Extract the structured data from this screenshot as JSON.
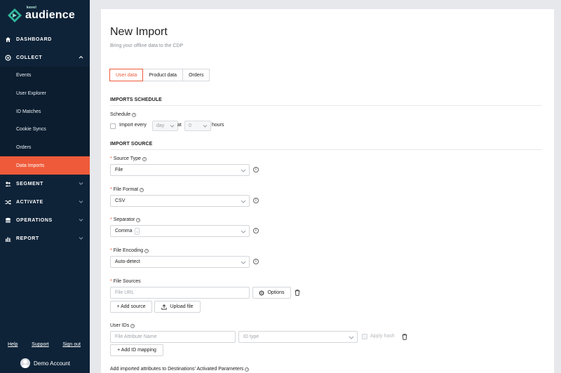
{
  "app": {
    "brand_small": "kevel",
    "brand_name": "audience",
    "accent": "#ef5a3a",
    "sidebar_bg": "#0e2338"
  },
  "sidebar": {
    "sections": [
      {
        "label": "DASHBOARD",
        "icon": "home-icon"
      },
      {
        "label": "COLLECT",
        "icon": "target-icon",
        "expanded": true
      },
      {
        "label": "SEGMENT",
        "icon": "users-icon"
      },
      {
        "label": "ACTIVATE",
        "icon": "shuffle-icon"
      },
      {
        "label": "OPERATIONS",
        "icon": "database-icon"
      },
      {
        "label": "REPORT",
        "icon": "bar-chart-icon"
      }
    ],
    "collect_items": [
      {
        "label": "Events"
      },
      {
        "label": "User Explorer"
      },
      {
        "label": "ID Matches"
      },
      {
        "label": "Cookie Syncs"
      },
      {
        "label": "Orders"
      },
      {
        "label": "Data Imports",
        "active": true
      }
    ],
    "links": {
      "help": "Help",
      "support": "Support",
      "signout": "Sign out"
    },
    "account": "Demo Account"
  },
  "page": {
    "title": "New Import",
    "subtitle": "Bring your offline data to the CDP",
    "tabs": [
      "User data",
      "Product data",
      "Orders"
    ],
    "active_tab": "User data"
  },
  "schedule": {
    "section": "IMPORTS SCHEDULE",
    "label": "Schedule",
    "import_every": "Import every",
    "unit_value": "day",
    "at": "at",
    "hour_value": "0",
    "hours": "hours",
    "checked": false
  },
  "source": {
    "section": "IMPORT SOURCE",
    "source_type_label": "Source Type",
    "source_type_value": "File",
    "file_format_label": "File Format",
    "file_format_value": "CSV",
    "separator_label": "Separator",
    "separator_value": "Comma",
    "separator_char": ",",
    "encoding_label": "File Encoding",
    "encoding_value": "Auto-detect",
    "file_sources_label": "File Sources",
    "file_url_placeholder": "File URL",
    "options_button": "Options",
    "add_source_button": "+ Add source",
    "upload_file_button": "Upload file"
  },
  "user_ids": {
    "label": "User IDs",
    "attribute_placeholder": "File Attribute Name",
    "id_type_placeholder": "ID type",
    "apply_hash": "Apply hash",
    "add_mapping_button": "+ Add ID mapping"
  },
  "destinations": {
    "label": "Add imported attributes to Destinations' Activated Parameters"
  }
}
